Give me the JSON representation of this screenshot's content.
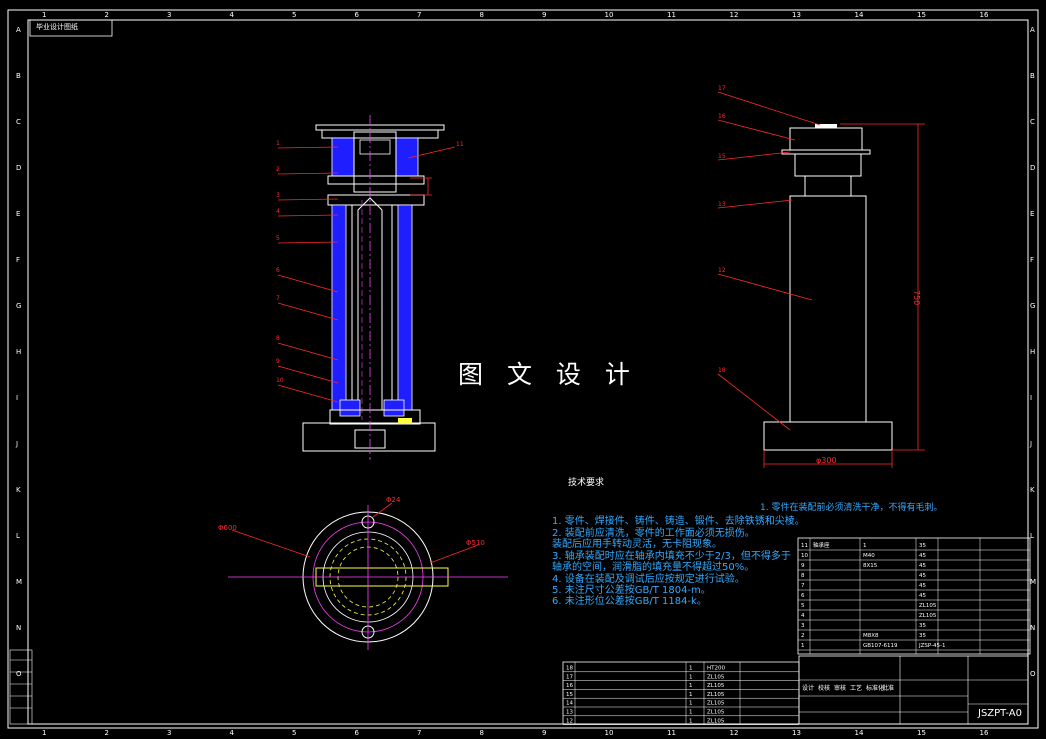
{
  "watermark": "图 文 设 计",
  "zone_tag": "毕业设计图纸",
  "grid_columns": [
    "1",
    "2",
    "3",
    "4",
    "5",
    "6",
    "7",
    "8",
    "9",
    "10",
    "11",
    "12",
    "13",
    "14",
    "15",
    "16"
  ],
  "grid_rows": [
    "A",
    "B",
    "C",
    "D",
    "E",
    "F",
    "G",
    "H",
    "I",
    "J",
    "K",
    "L",
    "M",
    "N",
    "O"
  ],
  "front_view_callouts": [
    "1",
    "2",
    "3",
    "4",
    "5",
    "6",
    "7",
    "8",
    "9",
    "10"
  ],
  "front_view_right_callouts": [
    "11"
  ],
  "side_view_callouts": [
    "17",
    "16",
    "15",
    "13",
    "12",
    "18"
  ],
  "dimensions": {
    "height": "750",
    "base_diameter": "φ300",
    "hole": "Φ24",
    "outer_circle": "Φ600",
    "bolt_circle": "Φ510"
  },
  "tech_requirements": {
    "title": "技术要求",
    "lines": [
      "1.  零件、焊接件、铸件、铸造、锻件、去除铁锈和尖棱。",
      "2.  装配前应清洗，零件的工作面必须无损伤。",
      "    装配后应用手转动灵活，无卡阻现象。",
      "3.  轴承装配时应在轴承内填充不少于2/3，但不得多于",
      "    轴承的空间，润滑脂的填充量不得超过50%。",
      "4.  设备在装配及调试后应按规定进行试验。",
      "5.  未注尺寸公差按GB/T 1804-m。",
      "6.  未注形位公差按GB/T 1184-k。"
    ]
  },
  "side_note": "1.  零件在装配前必须清洗干净，不得有毛刺。",
  "title_block": {
    "drawing_number": "JSZPT-A0",
    "labels": [
      "设计",
      "校核",
      "审核",
      "工艺",
      "标准化",
      "批准"
    ]
  },
  "parts_list_upper": [
    [
      "11",
      "轴承座",
      "1",
      "35"
    ],
    [
      "10",
      "",
      "M40",
      "45"
    ],
    [
      "9",
      "",
      "8X15",
      "45"
    ],
    [
      "8",
      "",
      "",
      "45"
    ],
    [
      "7",
      "",
      "",
      "45"
    ],
    [
      "6",
      "",
      "",
      "45"
    ],
    [
      "5",
      "",
      "",
      "ZL105"
    ],
    [
      "4",
      "",
      "",
      "ZL105"
    ],
    [
      "3",
      "",
      "",
      "35"
    ],
    [
      "2",
      "",
      "M8X8",
      "35"
    ],
    [
      "1",
      "",
      "GB107-6119",
      "JZSP-45-1"
    ]
  ],
  "parts_list_lower": [
    [
      "18",
      "",
      "1",
      "HT200"
    ],
    [
      "17",
      "",
      "1",
      "ZL105"
    ],
    [
      "16",
      "",
      "1",
      "ZL105"
    ],
    [
      "15",
      "",
      "1",
      "ZL105"
    ],
    [
      "14",
      "",
      "1",
      "ZL105"
    ],
    [
      "13",
      "",
      "1",
      "ZL105"
    ],
    [
      "12",
      "",
      "1",
      "ZL105"
    ]
  ],
  "colors": {
    "background": "#000000",
    "frame": "#ffffff",
    "leader": "#ff2a2a",
    "part_blue": "#1e1eff",
    "center_magenta": "#ff40ff",
    "hidden_yellow": "#ffff40",
    "text_cyan": "#33aaff"
  }
}
